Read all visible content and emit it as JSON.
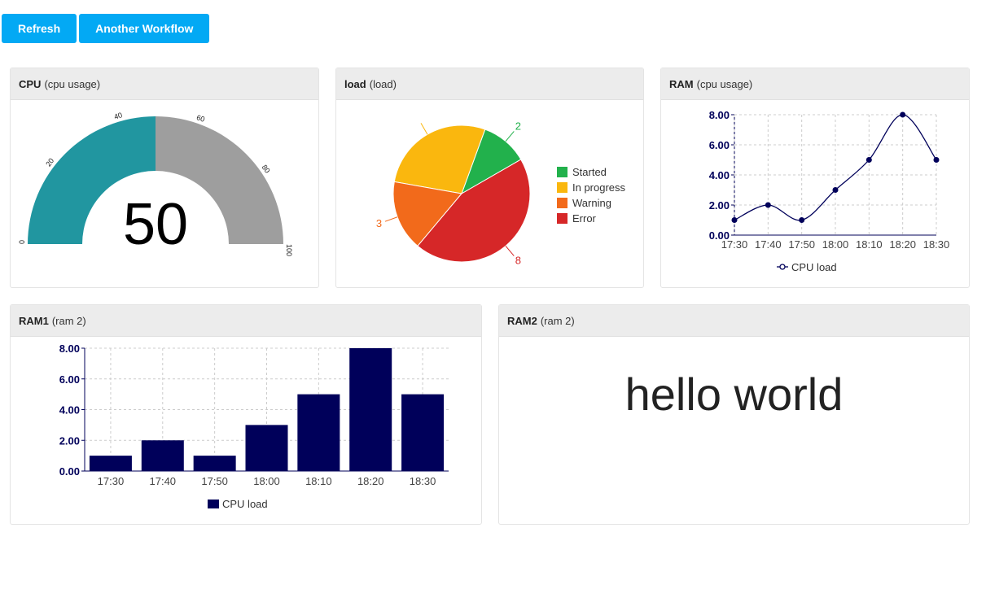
{
  "toolbar": {
    "refresh_label": "Refresh",
    "workflow_label": "Another Workflow"
  },
  "panels": {
    "cpu": {
      "title": "CPU",
      "subtitle": "(cpu usage)"
    },
    "load": {
      "title": "load",
      "subtitle": "(load)"
    },
    "ram": {
      "title": "RAM",
      "subtitle": "(cpu usage)"
    },
    "ram1": {
      "title": "RAM1",
      "subtitle": "(ram 2)"
    },
    "ram2": {
      "title": "RAM2",
      "subtitle": "(ram 2)",
      "text": "hello world"
    }
  },
  "colors": {
    "button": "#03a9f4",
    "gauge_value": "#2196a0",
    "gauge_rest": "#9e9e9e",
    "navy": "#00005a",
    "started": "#22b14c",
    "in_progress": "#fab70e",
    "warning": "#f26a1b",
    "error": "#d62728"
  },
  "chart_data": [
    {
      "type": "gauge",
      "value": 50,
      "display": "50",
      "min": 0,
      "max": 100,
      "ticks": [
        "0",
        "20",
        "40",
        "60",
        "80",
        "100"
      ]
    },
    {
      "type": "pie",
      "labels": [
        "Started",
        "In progress",
        "Warning",
        "Error"
      ],
      "values": [
        2,
        5,
        3,
        8
      ],
      "value_labels": [
        "2",
        "",
        "3",
        "8"
      ],
      "legend": "right"
    },
    {
      "type": "line",
      "categories": [
        "17:30",
        "17:40",
        "17:50",
        "18:00",
        "18:10",
        "18:20",
        "18:30"
      ],
      "series": [
        {
          "name": "CPU load",
          "values": [
            1,
            2,
            1,
            3,
            5,
            8,
            5
          ]
        }
      ],
      "yticks": [
        "0.00",
        "2.00",
        "4.00",
        "6.00",
        "8.00"
      ],
      "ylim": [
        0,
        8
      ],
      "grid": true,
      "legend": "bottom"
    },
    {
      "type": "bar",
      "categories": [
        "17:30",
        "17:40",
        "17:50",
        "18:00",
        "18:10",
        "18:20",
        "18:30"
      ],
      "series": [
        {
          "name": "CPU load",
          "values": [
            1,
            2,
            1,
            3,
            5,
            8,
            5
          ]
        }
      ],
      "yticks": [
        "0.00",
        "2.00",
        "4.00",
        "6.00",
        "8.00"
      ],
      "ylim": [
        0,
        8
      ],
      "grid": true,
      "legend": "bottom"
    }
  ]
}
